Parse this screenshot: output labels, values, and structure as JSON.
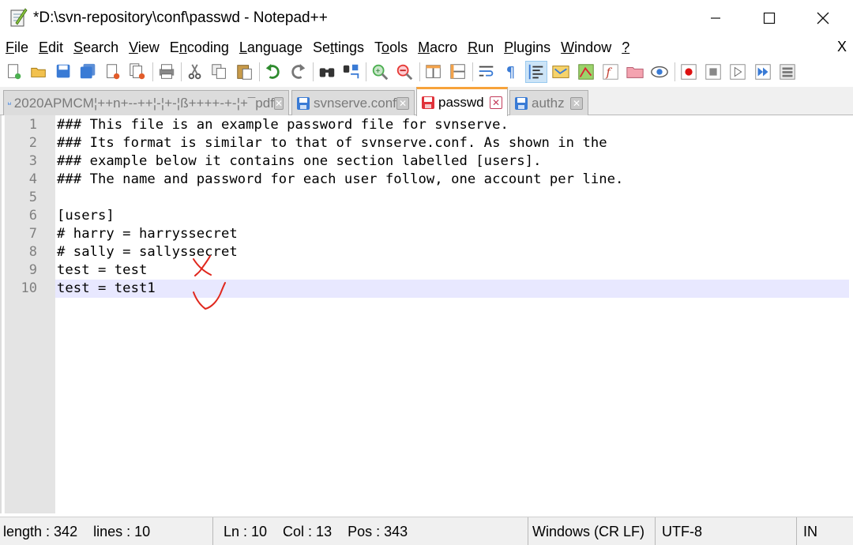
{
  "window": {
    "title": "*D:\\svn-repository\\conf\\passwd - Notepad++",
    "minimize_glyph": "—",
    "maximize_glyph": "☐",
    "close_glyph": "✕"
  },
  "menu": {
    "items": [
      {
        "u": "F",
        "rest": "ile"
      },
      {
        "u": "E",
        "rest": "dit"
      },
      {
        "u": "S",
        "rest": "earch"
      },
      {
        "u": "V",
        "rest": "iew"
      },
      {
        "pre": "E",
        "u": "n",
        "rest": "coding"
      },
      {
        "u": "L",
        "rest": "anguage"
      },
      {
        "pre": "Se",
        "u": "t",
        "rest": "tings"
      },
      {
        "pre": "T",
        "u": "o",
        "rest": "ols"
      },
      {
        "u": "M",
        "rest": "acro"
      },
      {
        "u": "R",
        "rest": "un"
      },
      {
        "u": "P",
        "rest": "lugins"
      },
      {
        "u": "W",
        "rest": "indow"
      },
      {
        "u": "?",
        "rest": ""
      }
    ],
    "close_label": "X"
  },
  "toolbar": {
    "icons": [
      "new-file-icon",
      "open-file-icon",
      "save-icon",
      "save-all-icon",
      "close-icon",
      "close-all-icon",
      "print-icon",
      "cut-icon",
      "copy-icon",
      "paste-icon",
      "undo-icon",
      "redo-icon",
      "find-icon",
      "replace-icon",
      "zoom-in-icon",
      "zoom-out-icon",
      "sync-vertical-icon",
      "sync-horizontal-icon",
      "word-wrap-icon",
      "show-all-chars-icon",
      "indent-guide-icon",
      "language-udl-icon",
      "document-map-icon",
      "function-list-icon",
      "folder-as-workspace-icon",
      "monitoring-icon",
      "record-macro-icon",
      "stop-record-icon",
      "play-macro-icon",
      "run-macro-multiple-icon",
      "save-macro-icon"
    ]
  },
  "tabs": [
    {
      "label": "2020APMCM¦++n+--++¦-¦+-¦ß++++-+-¦+¯pdf",
      "active": false,
      "disk_color": "#3a7bd5"
    },
    {
      "label": "svnserve.conf",
      "active": false,
      "disk_color": "#3a7bd5"
    },
    {
      "label": "passwd",
      "active": true,
      "disk_color": "#e0323a"
    },
    {
      "label": "authz",
      "active": false,
      "disk_color": "#3a7bd5"
    }
  ],
  "editor": {
    "lines": [
      {
        "n": "1",
        "text": "### This file is an example password file for svnserve."
      },
      {
        "n": "2",
        "text": "### Its format is similar to that of svnserve.conf. As shown in the"
      },
      {
        "n": "3",
        "text": "### example below it contains one section labelled [users]."
      },
      {
        "n": "4",
        "text": "### The name and password for each user follow, one account per line."
      },
      {
        "n": "5",
        "text": ""
      },
      {
        "n": "6",
        "text": "[users]"
      },
      {
        "n": "7",
        "text": "# harry = harryssecret"
      },
      {
        "n": "8",
        "text": "# sally = sallyssecret"
      },
      {
        "n": "9",
        "text": "test = test"
      },
      {
        "n": "10",
        "text": "test = test1"
      }
    ],
    "current_line": 10,
    "annotation_color": "#e0281e"
  },
  "status": {
    "length": "length : 342",
    "lines": "lines : 10",
    "ln": "Ln : 10",
    "col": "Col : 13",
    "pos": "Pos : 343",
    "eol": "Windows (CR LF)",
    "encoding": "UTF-8",
    "mode": "IN"
  }
}
